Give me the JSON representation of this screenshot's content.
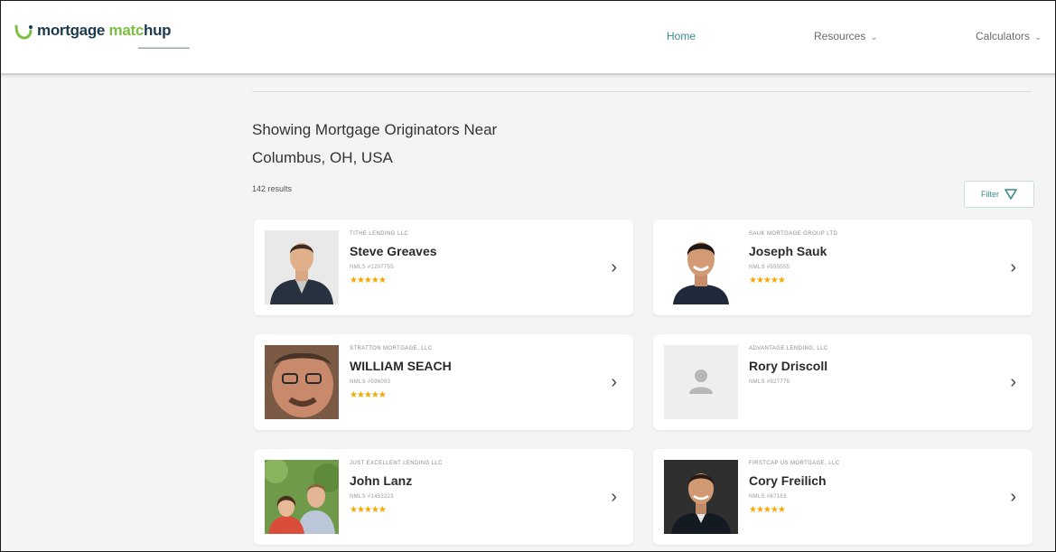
{
  "header": {
    "logo": {
      "word1": "mortgage",
      "word2": "matc",
      "word3": "hup"
    },
    "nav": [
      {
        "label": "Home"
      },
      {
        "label": "Resources"
      },
      {
        "label": "Calculators"
      }
    ]
  },
  "main": {
    "title_line1": "Showing Mortgage Originators Near",
    "title_line2": "Columbus, OH, USA",
    "results": "142 results",
    "filter_label": "Filter"
  },
  "cards": [
    {
      "company": "TITHE LENDING LLC",
      "name": "Steve Greaves",
      "nmls": "NMLS #1207755",
      "stars": "★★★★★",
      "photo": "man-suit"
    },
    {
      "company": "SAUK MORTGAGE GROUP LTD",
      "name": "Joseph Sauk",
      "nmls": "NMLS #555555",
      "stars": "★★★★★",
      "photo": "man-smile"
    },
    {
      "company": "STRATTON MORTGAGE, LLC",
      "name": "WILLIAM SEACH",
      "nmls": "NMLS #596093",
      "stars": "★★★★★",
      "photo": "man-glasses"
    },
    {
      "company": "ADVANTAGE LENDING, LLC",
      "name": "Rory Driscoll",
      "nmls": "NMLS #827775",
      "stars": "",
      "photo": "placeholder"
    },
    {
      "company": "JUST EXCELLENT LENDING LLC",
      "name": "John Lanz",
      "nmls": "NMLS #1453323",
      "stars": "★★★★★",
      "photo": "couple"
    },
    {
      "company": "FIRSTCAP US MORTGAGE, LLC",
      "name": "Cory Freilich",
      "nmls": "NMLS #67163",
      "stars": "★★★★★",
      "photo": "man-dark"
    }
  ],
  "colors": {
    "brand_navy": "#1e3a4f",
    "brand_green": "#7bc043",
    "accent_teal": "#3a8a8a",
    "star": "#f2a900"
  }
}
